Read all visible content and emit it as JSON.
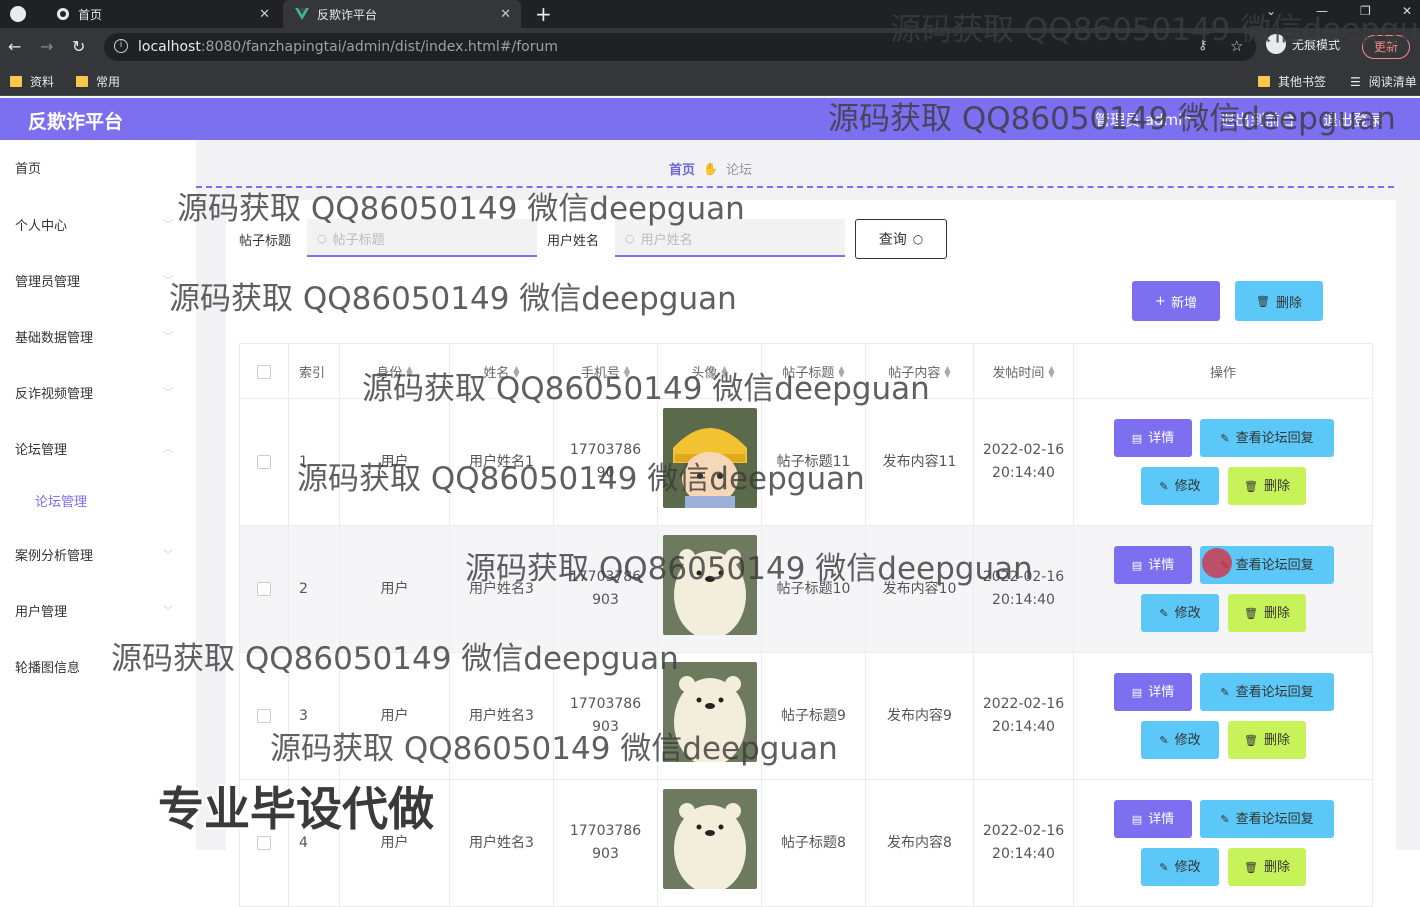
{
  "browser": {
    "tabs": [
      {
        "title": "首页",
        "icon": "globe-icon"
      },
      {
        "title": "反欺诈平台",
        "icon": "vue-icon"
      }
    ],
    "url_host": "localhost",
    "url_path": ":8080/fanzhapingtai/admin/dist/index.html#/forum",
    "incognito_label": "无痕模式",
    "update_label": "更新",
    "bookmarks": [
      "资料",
      "常用"
    ],
    "other_bookmarks": "其他书签",
    "reading_list": "阅读清单"
  },
  "header": {
    "logo": "反欺诈平台",
    "admin": "管理员 admin",
    "to_front": "退出到前台",
    "logout": "退出登录"
  },
  "sidebar": {
    "items": [
      "首页",
      "个人中心",
      "管理员管理",
      "基础数据管理",
      "反诈视频管理",
      "论坛管理",
      "论坛管理",
      "案例分析管理",
      "用户管理",
      "轮播图信息"
    ]
  },
  "breadcrumb": {
    "home": "首页",
    "current": "论坛"
  },
  "filters": {
    "title_label": "帖子标题",
    "title_placeholder": "帖子标题",
    "user_label": "用户姓名",
    "user_placeholder": "用户姓名",
    "search_btn": "查询"
  },
  "toolbar": {
    "add": "新增",
    "delete": "删除"
  },
  "table": {
    "headers": [
      "索引",
      "身份",
      "姓名",
      "手机号",
      "头像",
      "帖子标题",
      "帖子内容",
      "发帖时间",
      "操作"
    ],
    "rows": [
      {
        "index": "1",
        "role": "用户",
        "name": "用户姓名1",
        "phone": "1770378690",
        "title": "帖子标题11",
        "content": "发布内容11",
        "date": "2022-02-16",
        "time": "20:14:40"
      },
      {
        "index": "2",
        "role": "用户",
        "name": "用户姓名3",
        "phone": "17703786903",
        "title": "帖子标题10",
        "content": "发布内容10",
        "date": "2022-02-16",
        "time": "20:14:40"
      },
      {
        "index": "3",
        "role": "用户",
        "name": "用户姓名3",
        "phone": "17703786903",
        "title": "帖子标题9",
        "content": "发布内容9",
        "date": "2022-02-16",
        "time": "20:14:40"
      },
      {
        "index": "4",
        "role": "用户",
        "name": "用户姓名3",
        "phone": "17703786903",
        "title": "帖子标题8",
        "content": "发布内容8",
        "date": "2022-02-16",
        "time": "20:14:40"
      }
    ],
    "actions": {
      "detail": "详情",
      "reply": "查看论坛回复",
      "edit": "修改",
      "delete": "删除"
    }
  },
  "watermark": {
    "text": "源码获取 QQ86050149 微信deepguan",
    "big": "专业毕设代做"
  },
  "colors": {
    "accent": "#7c6ff0",
    "cyan": "#5bc8f7",
    "lime": "#c8f25a"
  }
}
